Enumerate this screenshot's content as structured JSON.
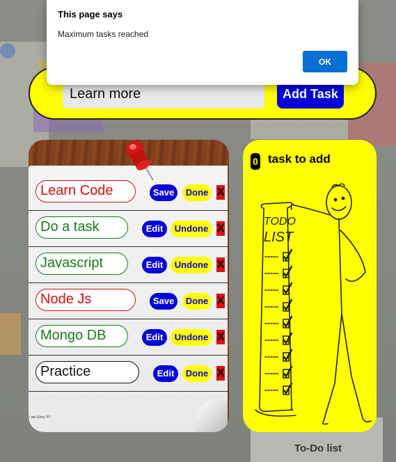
{
  "dialog": {
    "title": "This page says",
    "message": "Maximum tasks reached",
    "ok_label": "OK"
  },
  "input": {
    "value": "Learn more",
    "add_label": "Add Task"
  },
  "tasks": [
    {
      "text": "Learn Code",
      "primary_label": "Save",
      "secondary_label": "Done",
      "delete": "X"
    },
    {
      "text": "Do a task",
      "primary_label": "Edit",
      "secondary_label": "Undone",
      "delete": "X"
    },
    {
      "text": "Javascript",
      "primary_label": "Edit",
      "secondary_label": "Undone",
      "delete": "X"
    },
    {
      "text": "Node Js",
      "primary_label": "Save",
      "secondary_label": "Done",
      "delete": "X"
    },
    {
      "text": "Mongo DB",
      "primary_label": "Edit",
      "secondary_label": "Undone",
      "delete": "X"
    },
    {
      "text": "Practice",
      "primary_label": "Edit",
      "secondary_label": "Done",
      "delete": "X"
    }
  ],
  "list_footer": "I am Sorry !!!!",
  "info": {
    "count": "0",
    "text": "task to add"
  },
  "background_label": "To-Do list",
  "colors": {
    "accent_yellow": "#ffff00",
    "button_blue": "#0505d8",
    "dialog_ok": "#0a6fd3"
  }
}
